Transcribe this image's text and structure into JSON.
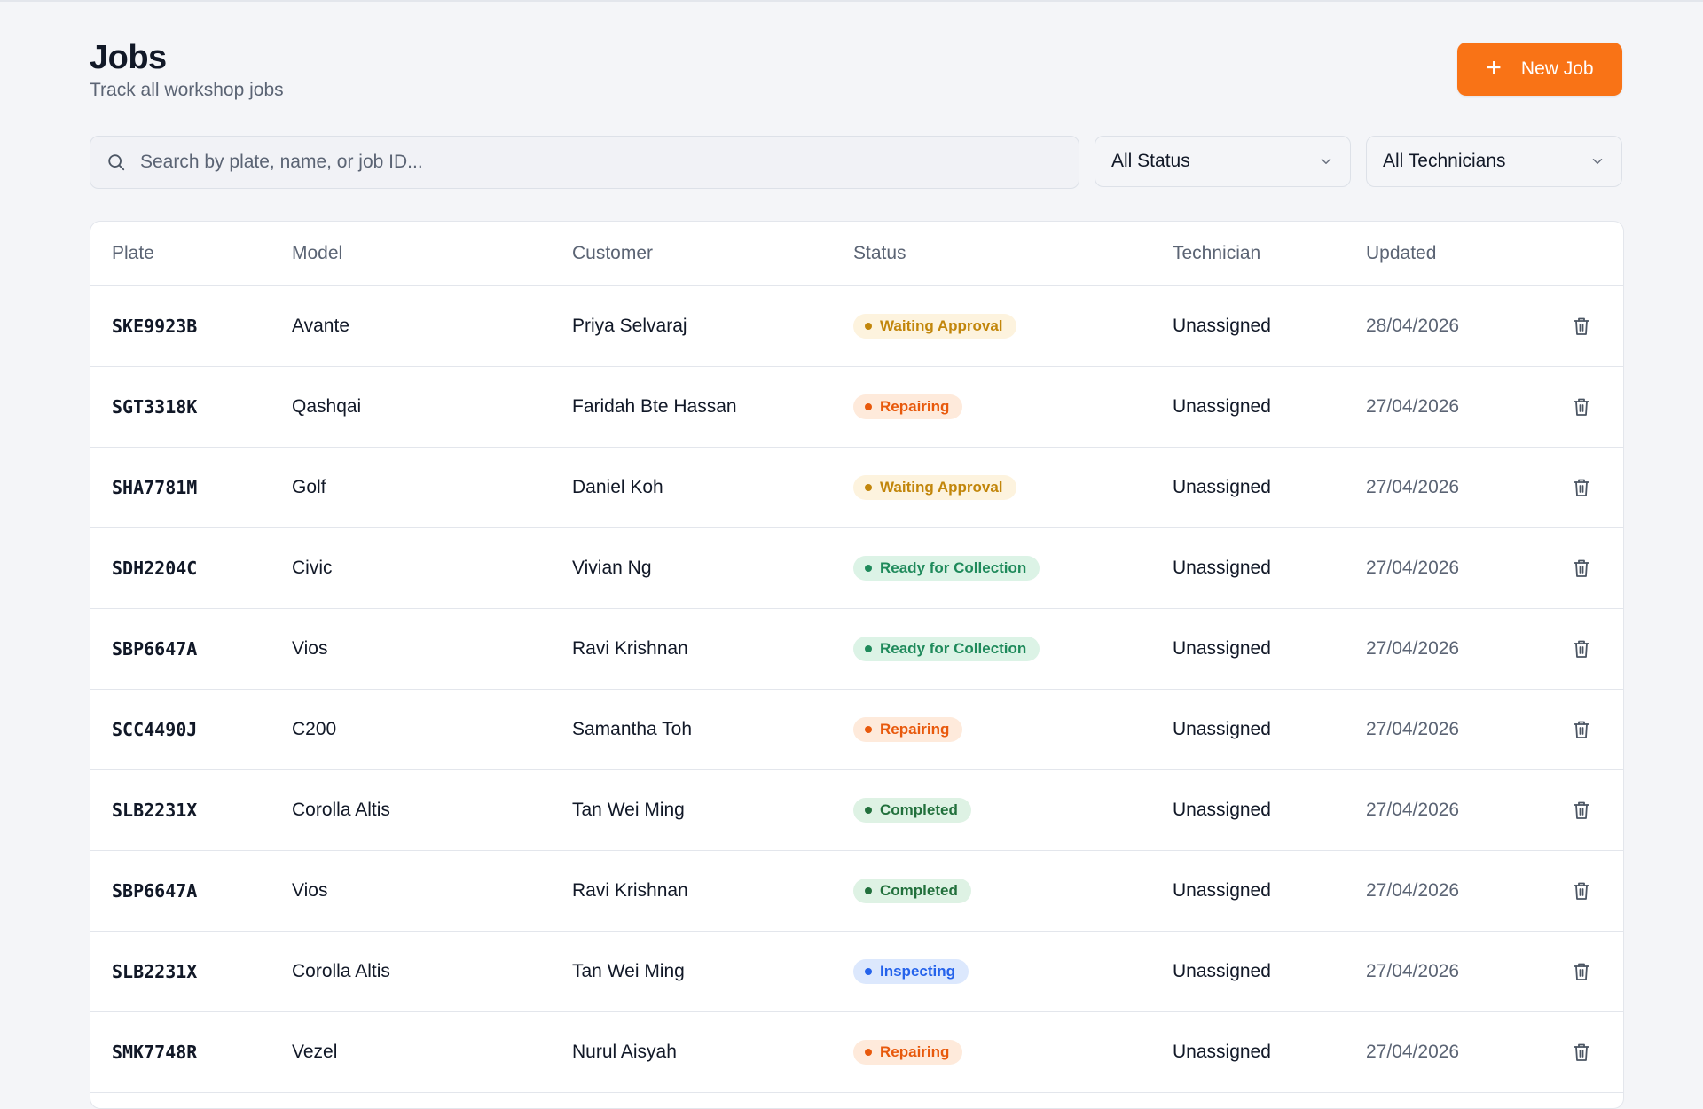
{
  "header": {
    "title": "Jobs",
    "subtitle": "Track all workshop jobs",
    "new_job_label": "New Job"
  },
  "filters": {
    "search_placeholder": "Search by plate, name, or job ID...",
    "status_selected": "All Status",
    "technician_selected": "All Technicians"
  },
  "table": {
    "columns": [
      "Plate",
      "Model",
      "Customer",
      "Status",
      "Technician",
      "Updated"
    ],
    "rows": [
      {
        "plate": "SKE9923B",
        "model": "Avante",
        "customer": "Priya Selvaraj",
        "status": "Waiting Approval",
        "status_kind": "waiting",
        "technician": "Unassigned",
        "updated": "28/04/2026"
      },
      {
        "plate": "SGT3318K",
        "model": "Qashqai",
        "customer": "Faridah Bte Hassan",
        "status": "Repairing",
        "status_kind": "repairing",
        "technician": "Unassigned",
        "updated": "27/04/2026"
      },
      {
        "plate": "SHA7781M",
        "model": "Golf",
        "customer": "Daniel Koh",
        "status": "Waiting Approval",
        "status_kind": "waiting",
        "technician": "Unassigned",
        "updated": "27/04/2026"
      },
      {
        "plate": "SDH2204C",
        "model": "Civic",
        "customer": "Vivian Ng",
        "status": "Ready for Collection",
        "status_kind": "ready",
        "technician": "Unassigned",
        "updated": "27/04/2026"
      },
      {
        "plate": "SBP6647A",
        "model": "Vios",
        "customer": "Ravi Krishnan",
        "status": "Ready for Collection",
        "status_kind": "ready",
        "technician": "Unassigned",
        "updated": "27/04/2026"
      },
      {
        "plate": "SCC4490J",
        "model": "C200",
        "customer": "Samantha Toh",
        "status": "Repairing",
        "status_kind": "repairing",
        "technician": "Unassigned",
        "updated": "27/04/2026"
      },
      {
        "plate": "SLB2231X",
        "model": "Corolla Altis",
        "customer": "Tan Wei Ming",
        "status": "Completed",
        "status_kind": "completed",
        "technician": "Unassigned",
        "updated": "27/04/2026"
      },
      {
        "plate": "SBP6647A",
        "model": "Vios",
        "customer": "Ravi Krishnan",
        "status": "Completed",
        "status_kind": "completed",
        "technician": "Unassigned",
        "updated": "27/04/2026"
      },
      {
        "plate": "SLB2231X",
        "model": "Corolla Altis",
        "customer": "Tan Wei Ming",
        "status": "Inspecting",
        "status_kind": "inspecting",
        "technician": "Unassigned",
        "updated": "27/04/2026"
      },
      {
        "plate": "SMK7748R",
        "model": "Vezel",
        "customer": "Nurul Aisyah",
        "status": "Repairing",
        "status_kind": "repairing",
        "technician": "Unassigned",
        "updated": "27/04/2026"
      }
    ]
  },
  "icons": {
    "search": "search-icon",
    "dropdown": "chevron-down-icon",
    "delete": "trash-icon",
    "add": "plus-icon"
  },
  "colors": {
    "accent": "#f97316",
    "waiting": "#c2860b",
    "repairing": "#e8590c",
    "ready": "#1f8a5b",
    "completed": "#22703c",
    "inspecting": "#2563eb"
  }
}
